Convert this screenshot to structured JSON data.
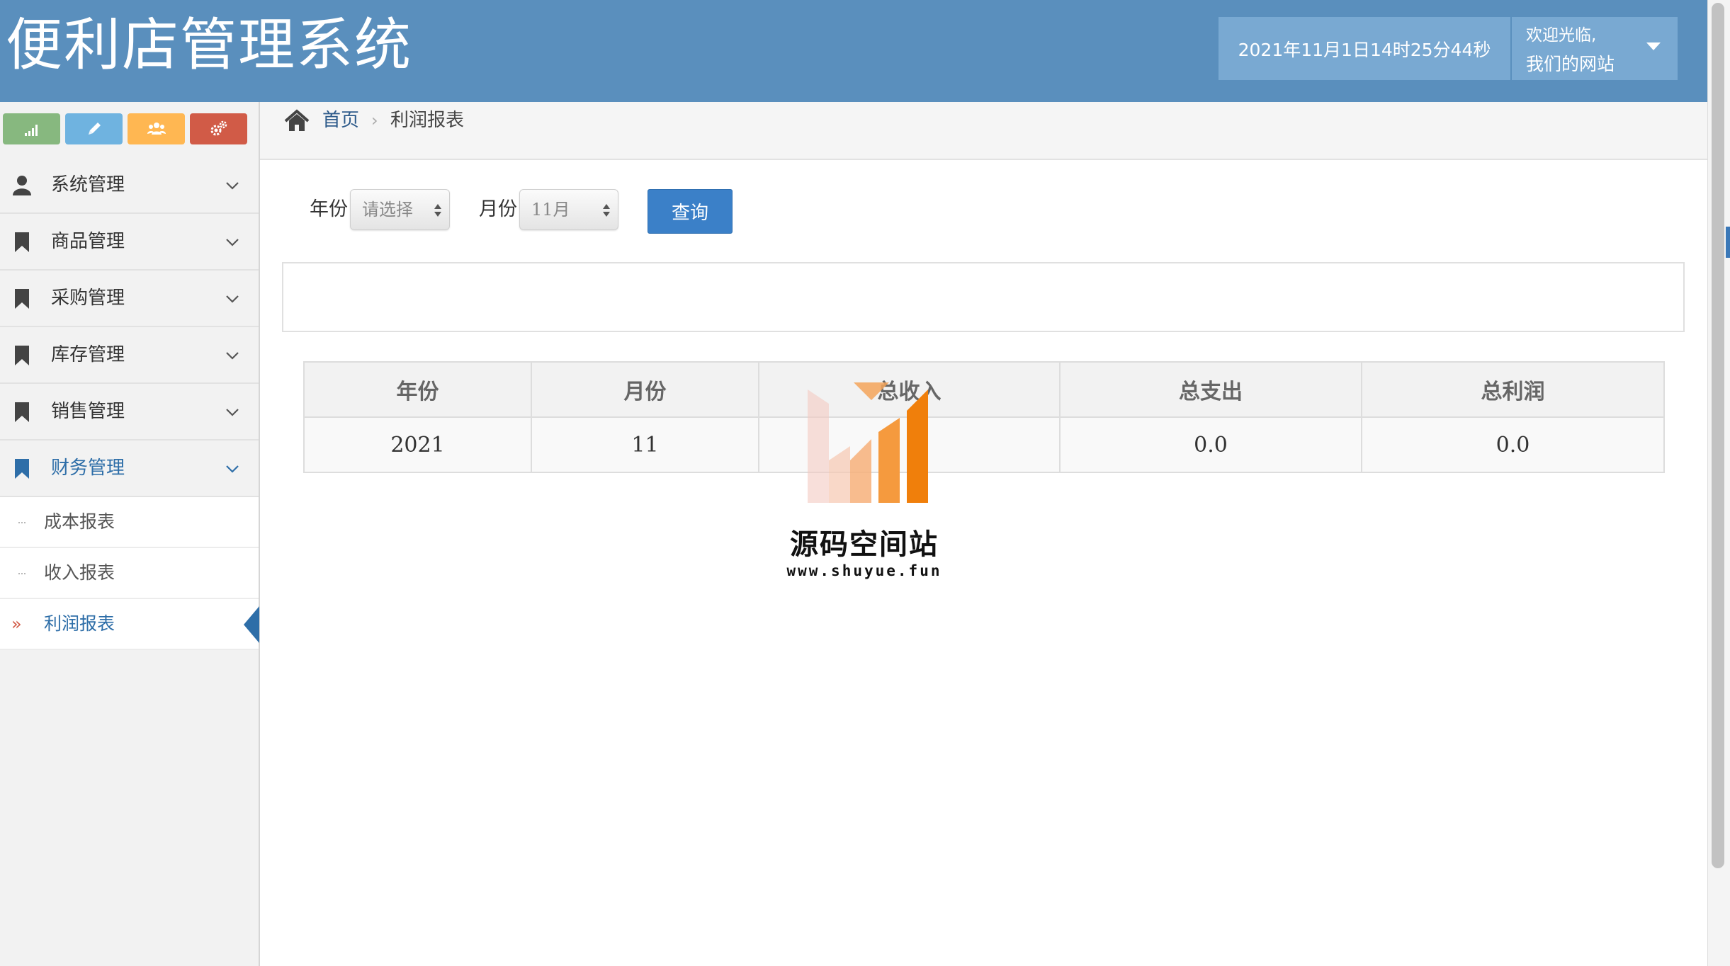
{
  "app": {
    "title": "便利店管理系统",
    "clock": "2021年11月1日14时25分44秒",
    "user_greeting": "欢迎光临,",
    "user_name": "我们的网站"
  },
  "shortcuts": [
    {
      "name": "stats",
      "color": "#87b87f",
      "icon": "signal-bars-icon"
    },
    {
      "name": "edit",
      "color": "#6fb3e0",
      "icon": "pencil-icon"
    },
    {
      "name": "users",
      "color": "#ffb752",
      "icon": "users-icon"
    },
    {
      "name": "settings",
      "color": "#d15b47",
      "icon": "cogs-icon"
    }
  ],
  "sidebar": {
    "items": [
      {
        "label": "系统管理",
        "icon": "user-icon"
      },
      {
        "label": "商品管理",
        "icon": "bookmark-icon"
      },
      {
        "label": "采购管理",
        "icon": "bookmark-icon"
      },
      {
        "label": "库存管理",
        "icon": "bookmark-icon"
      },
      {
        "label": "销售管理",
        "icon": "bookmark-icon"
      },
      {
        "label": "财务管理",
        "icon": "bookmark-icon",
        "active": true
      }
    ],
    "finance_sub": [
      {
        "label": "成本报表"
      },
      {
        "label": "收入报表"
      },
      {
        "label": "利润报表",
        "active": true
      }
    ]
  },
  "breadcrumb": {
    "home": "首页",
    "separator": "›",
    "current": "利润报表"
  },
  "filters": {
    "year_label": "年份",
    "year_value": "请选择",
    "month_label": "月份",
    "month_value": "11月",
    "query_label": "查询"
  },
  "table": {
    "headers": [
      "年份",
      "月份",
      "总收入",
      "总支出",
      "总利润"
    ],
    "rows": [
      [
        "2021",
        "11",
        "",
        "0.0",
        "0.0"
      ]
    ]
  },
  "watermark": {
    "name": "源码空间站",
    "url": "www.shuyue.fun"
  },
  "colors": {
    "header_bg": "#5a8fbd",
    "header_box": "#79a9d2",
    "accent": "#2e6ea8",
    "button": "#3b80c8"
  }
}
